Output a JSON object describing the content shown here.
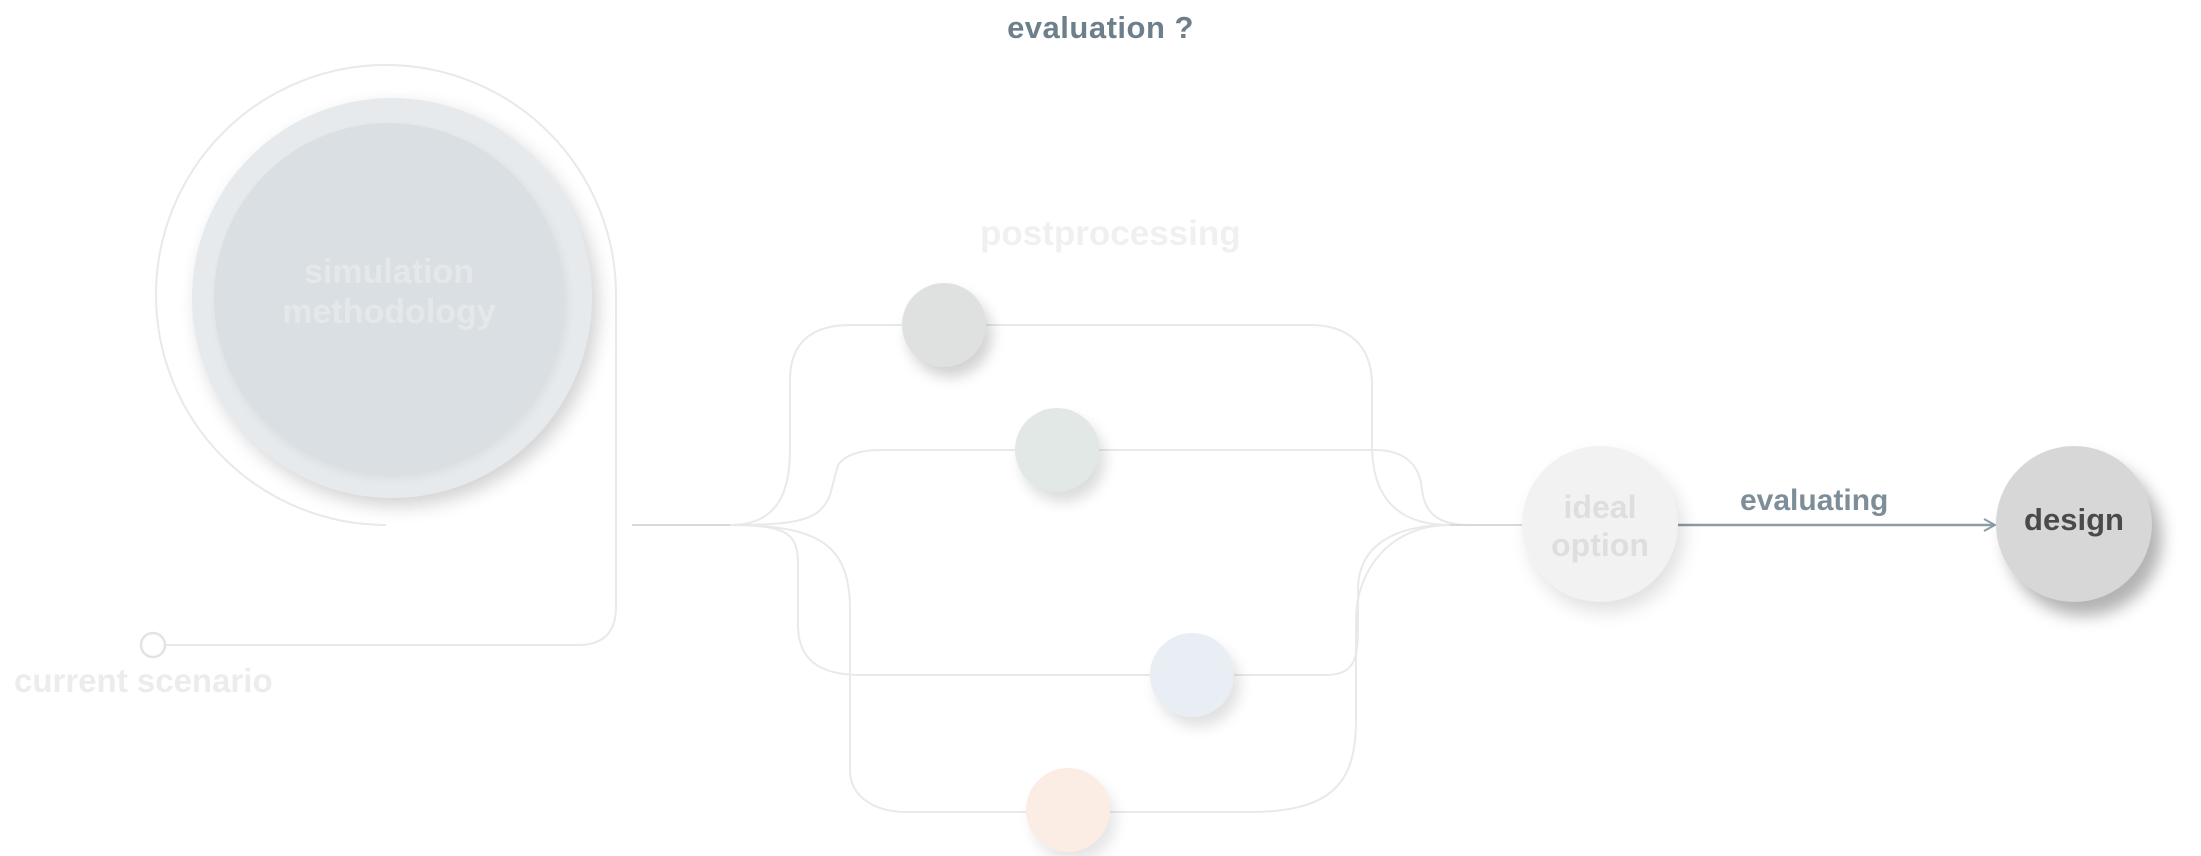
{
  "title": "evaluation ?",
  "main_node": {
    "label": "simulation\nmethodology"
  },
  "branch_label": "postprocessing",
  "result_node": {
    "label": "ideal\noption"
  },
  "arrow_label": "evaluating",
  "target_node": {
    "label": "design"
  },
  "start_label": "current scenario",
  "colors": {
    "title": "#6d7f8a",
    "arrow": "#8b9ca6",
    "connector": "#e8e8e8",
    "design_fill": "#d7d7d7"
  }
}
